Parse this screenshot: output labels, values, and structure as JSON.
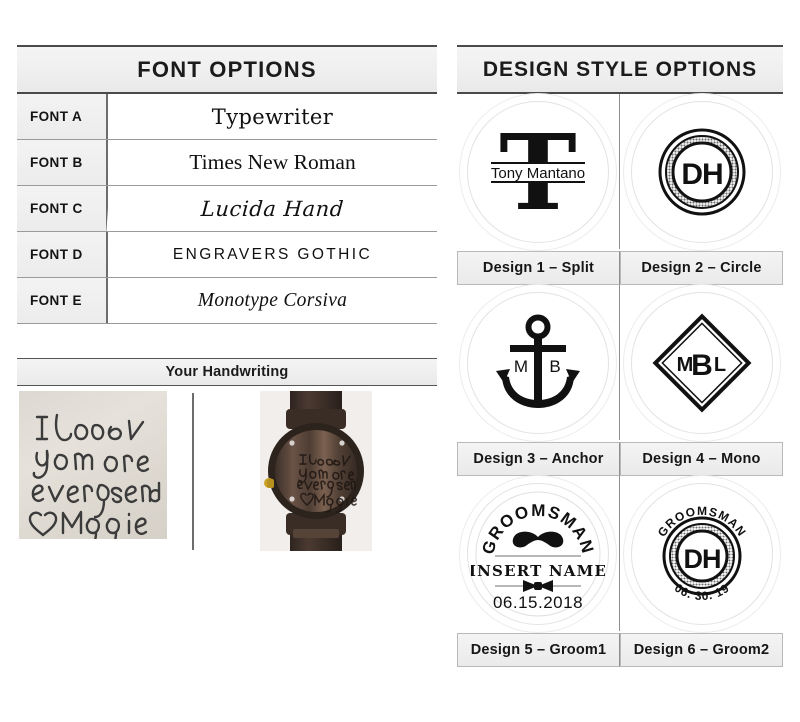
{
  "font_options": {
    "title": "FONT OPTIONS",
    "rows": [
      {
        "code": "FONT A",
        "sample": "Typewriter"
      },
      {
        "code": "FONT B",
        "sample": "Times New Roman"
      },
      {
        "code": "FONT C",
        "sample": "Lucida Hand"
      },
      {
        "code": "FONT D",
        "sample": "Engravers Gothic"
      },
      {
        "code": "FONT E",
        "sample": "Monotype Corsiva"
      }
    ]
  },
  "handwriting": {
    "title": "Your Handwriting",
    "note_lines": [
      "I Love",
      "you more",
      "every second",
      "♡ Maggie"
    ],
    "watch_engraving_lines": [
      "I Love",
      "you more",
      "every second",
      "♡ Maggie"
    ]
  },
  "design_options": {
    "title": "DESIGN STYLE OPTIONS",
    "designs": [
      {
        "label": "Design 1 – Split",
        "art_type": "split-initial",
        "initial": "T",
        "name": "Tony Mantano"
      },
      {
        "label": "Design 2 – Circle",
        "art_type": "circle-monogram",
        "initials": "DH"
      },
      {
        "label": "Design 3 – Anchor",
        "art_type": "anchor-monogram",
        "left_initial": "M",
        "right_initial": "B"
      },
      {
        "label": "Design 4 – Mono",
        "art_type": "diamond-monogram",
        "initials": "MBL",
        "initial_left": "M",
        "initial_center": "B",
        "initial_right": "L"
      },
      {
        "label": "Design 5 – Groom1",
        "art_type": "groomsman-badge",
        "arc_text": "GROOMSMAN",
        "name_text": "INSERT NAME",
        "date_text": "06.15.2018"
      },
      {
        "label": "Design 6 – Groom2",
        "art_type": "groomsman-circle",
        "arc_text": "GROOMSMAN",
        "initials": "DH",
        "date_text": "06. 30. 19"
      }
    ]
  },
  "colors": {
    "ink": "#111111",
    "header_bg": "#efefef",
    "border": "#4a4a4a",
    "halftone_gray": "#9a9a9a",
    "note_paper": "#ded9d2",
    "watch_wood": "#4a3b33"
  }
}
